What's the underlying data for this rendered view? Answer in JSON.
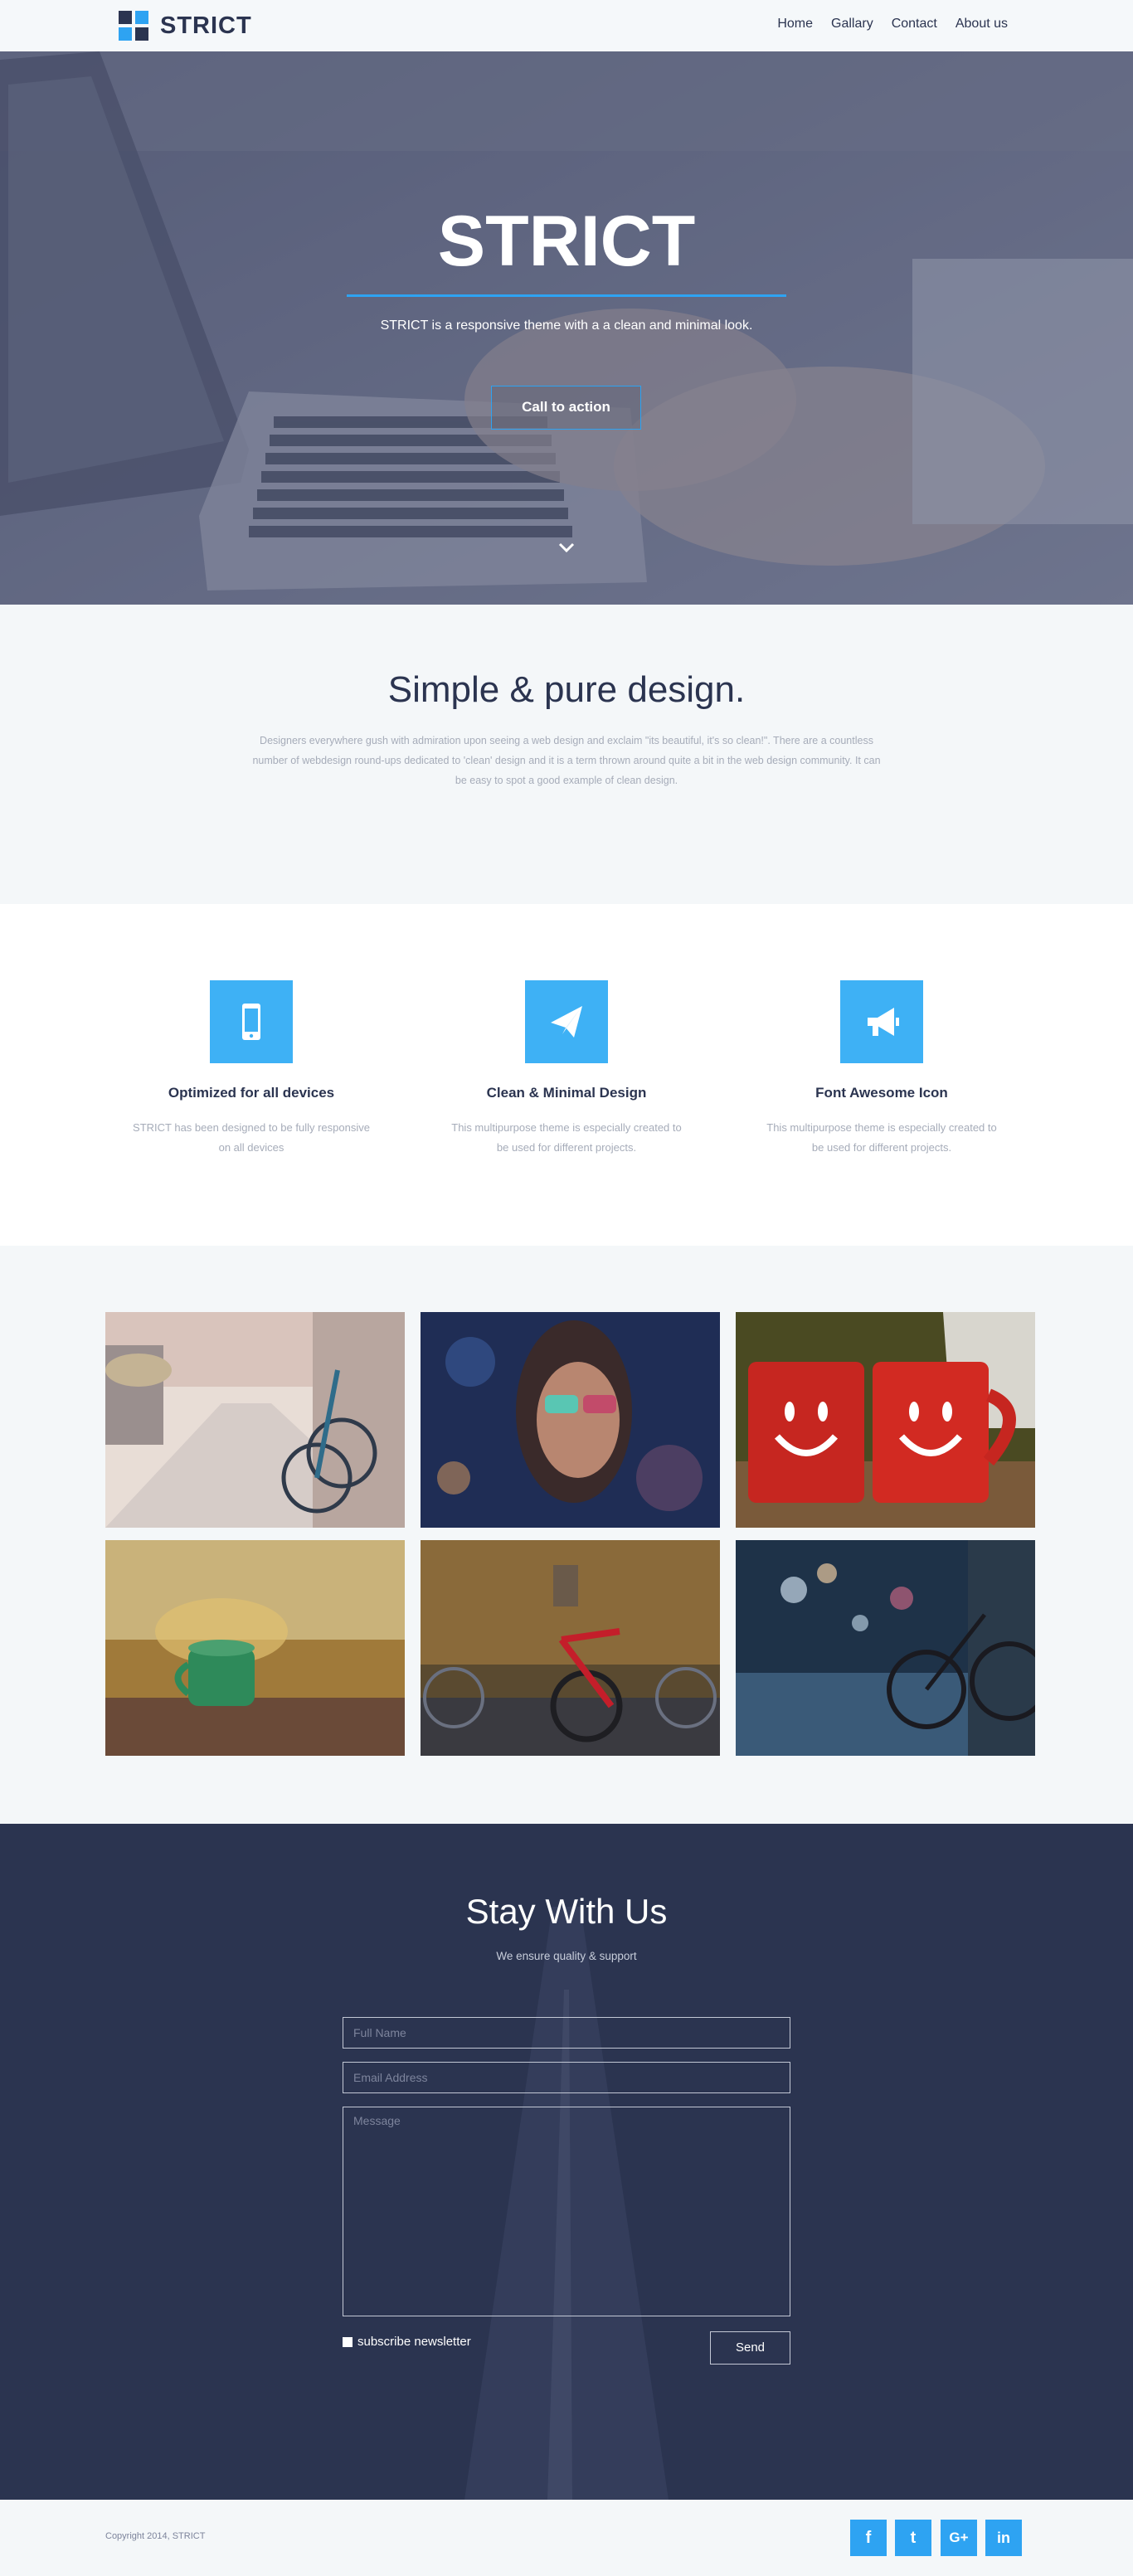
{
  "nav": {
    "logo": "STRICT",
    "links": [
      "Home",
      "Gallary",
      "Contact",
      "About us"
    ]
  },
  "hero": {
    "title": "STRICT",
    "subtitle": "STRICT is a responsive theme with a a clean and minimal look.",
    "cta": "Call to action"
  },
  "intro": {
    "title": "Simple & pure design.",
    "text": "Designers everywhere gush with admiration upon seeing a web design and exclaim \"its beautiful, it's so clean!\". There are a countless number of webdesign round-ups dedicated to 'clean' design and it is a term thrown around quite a bit in the web design community. It can be easy to spot a good example of clean design."
  },
  "features": [
    {
      "icon": "mobile-icon",
      "title": "Optimized for all devices",
      "text": "STRICT has been designed to be fully responsive on all devices"
    },
    {
      "icon": "paper-plane-icon",
      "title": "Clean & Minimal Design",
      "text": "This multipurpose theme is especially created to be used for different projects."
    },
    {
      "icon": "bullhorn-icon",
      "title": "Font Awesome Icon",
      "text": "This multipurpose theme is especially created to be used for different projects."
    }
  ],
  "contact": {
    "title": "Stay With Us",
    "subtitle": "We ensure quality & support",
    "name_placeholder": "Full Name",
    "email_placeholder": "Email Address",
    "message_placeholder": "Message",
    "newsletter_label": "subscribe newsletter",
    "send_label": "Send"
  },
  "footer": {
    "copyright": "Copyright 2014, STRICT",
    "social": [
      {
        "icon": "facebook-icon",
        "glyph": "f"
      },
      {
        "icon": "twitter-icon",
        "glyph": "t"
      },
      {
        "icon": "google-plus-icon",
        "glyph": "G+"
      },
      {
        "icon": "linkedin-icon",
        "glyph": "in"
      }
    ]
  },
  "colors": {
    "accent": "#2ea3f2",
    "dark": "#2b3450",
    "light_bg": "#f4f7f9"
  }
}
